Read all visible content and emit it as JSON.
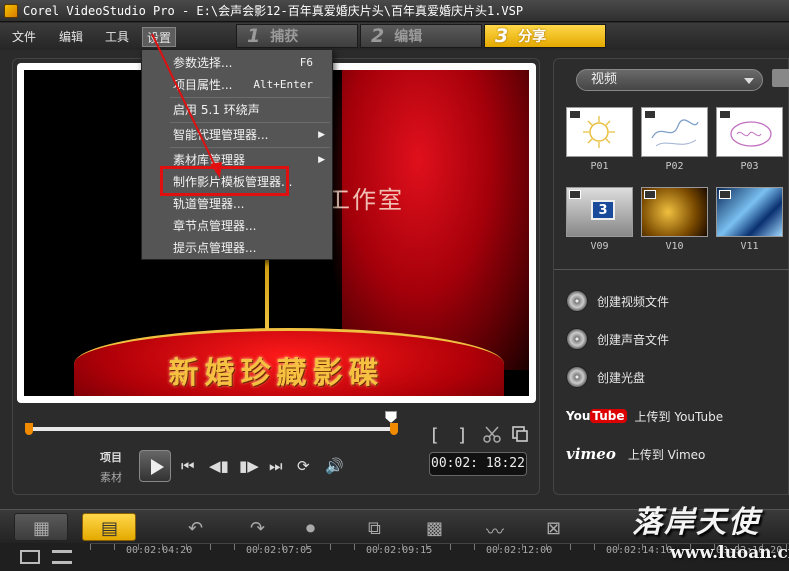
{
  "window": {
    "title": "Corel VideoStudio Pro - E:\\会声会影12-百年真爱婚庆片头\\百年真爱婚庆片头1.VSP"
  },
  "menubar": {
    "items": [
      {
        "label": "文件"
      },
      {
        "label": "编辑"
      },
      {
        "label": "工具"
      },
      {
        "label": "设置"
      }
    ]
  },
  "steps": [
    {
      "num": "1",
      "label": "捕获"
    },
    {
      "num": "2",
      "label": "编辑"
    },
    {
      "num": "3",
      "label": "分享"
    }
  ],
  "settings_menu": {
    "items": [
      {
        "label": "参数选择...",
        "shortcut": "F6"
      },
      {
        "label": "项目属性...",
        "shortcut": "Alt+Enter"
      },
      {
        "label": "启用 5.1 环绕声"
      },
      {
        "label": "智能代理管理器...",
        "submenu": "▶"
      },
      {
        "label": "素材库管理器",
        "submenu": "▶"
      },
      {
        "label": "制作影片模板管理器..."
      },
      {
        "label": "轨道管理器..."
      },
      {
        "label": "章节点管理器..."
      },
      {
        "label": "提示点管理器..."
      }
    ]
  },
  "preview": {
    "studio_text": "工作室",
    "banner_text": "新婚珍藏影碟",
    "mark_in": "[",
    "mark_out": "]",
    "mode_project": "项目",
    "mode_clip": "素材",
    "timecode": "00:02: 18:22"
  },
  "library": {
    "dropdown": "视频",
    "thumbs": [
      {
        "label": "P01"
      },
      {
        "label": "P02"
      },
      {
        "label": "P03"
      },
      {
        "label": "V09",
        "badge_text": "3"
      },
      {
        "label": "V10"
      },
      {
        "label": "V11"
      }
    ],
    "share": {
      "create_video": "创建视频文件",
      "create_audio": "创建声音文件",
      "create_disc": "创建光盘",
      "youtube_logo_a": "You",
      "youtube_logo_b": "Tube",
      "youtube_label": "上传到 YouTube",
      "vimeo_logo": "vimeo",
      "vimeo_label": "上传到 Vimeo"
    }
  },
  "timeline": {
    "ruler": [
      "00:02:04:20",
      "00:02:07:05",
      "00:02:09:15",
      "00:02:12:00",
      "00:02:14:10",
      "00:02:16:20"
    ]
  },
  "watermark": {
    "text": "落岸天使",
    "url": "www.luoan.cn"
  },
  "colors": {
    "accent": "#e4a900",
    "highlight": "#e01010"
  }
}
